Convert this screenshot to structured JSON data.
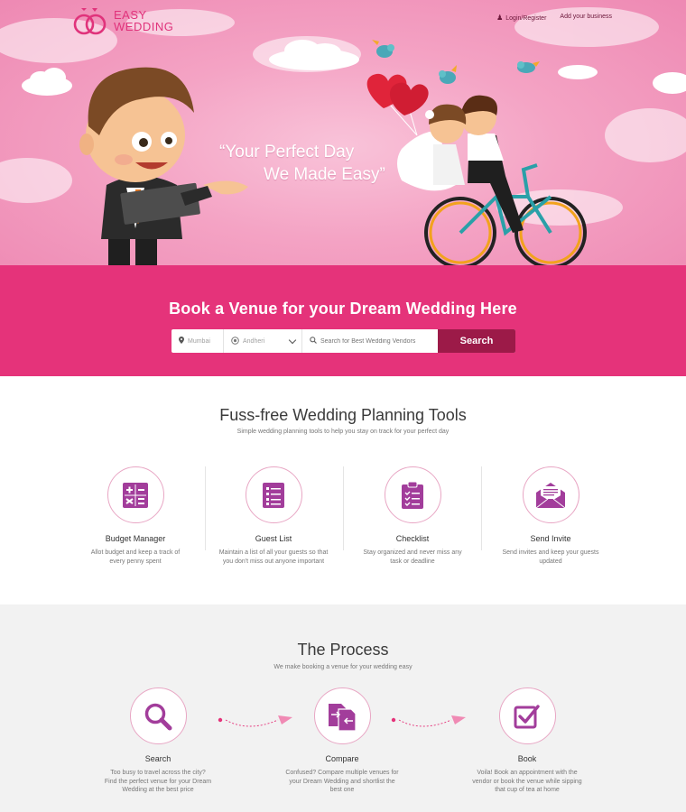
{
  "header": {
    "logo_line1": "EASY",
    "logo_line2": "WEDDING",
    "login_label": "Login/Register",
    "add_business_label": "Add your business"
  },
  "hero": {
    "quote_line1": "“Your Perfect Day",
    "quote_line2": "We Made Easy”"
  },
  "search": {
    "heading": "Book a Venue for your Dream Wedding Here",
    "city_value": "Mumbai",
    "area_value": "Andheri",
    "vendor_placeholder": "Search for Best Wedding Vendors",
    "button_label": "Search"
  },
  "tools": {
    "heading": "Fuss-free Wedding Planning Tools",
    "subheading": "Simple wedding planning tools to help you stay on track for your perfect day",
    "items": [
      {
        "title": "Budget Manager",
        "desc1": "Allot budget and keep a track of",
        "desc2": "every penny spent",
        "icon": "calculator-icon"
      },
      {
        "title": "Guest List",
        "desc1": "Maintain a list of all your guests so that",
        "desc2": "you don't miss out anyone important",
        "icon": "guest-list-icon"
      },
      {
        "title": "Checklist",
        "desc1": "Stay organized and never miss any",
        "desc2": "task or deadline",
        "icon": "clipboard-checklist-icon"
      },
      {
        "title": "Send Invite",
        "desc1": "Send invites and keep your guests",
        "desc2": "updated",
        "icon": "envelope-icon"
      }
    ]
  },
  "process": {
    "heading": "The Process",
    "subheading": "We make booking a venue for your wedding easy",
    "steps": [
      {
        "title": "Search",
        "desc1": "Too busy to travel across the city?",
        "desc2": "Find the perfect venue for your Dream",
        "desc3": "Wedding at the best price",
        "icon": "magnifier-icon"
      },
      {
        "title": "Compare",
        "desc1": "Confused? Compare multiple venues for",
        "desc2": "your Dream Wedding and shortlist the",
        "desc3": "best one",
        "icon": "compare-documents-icon"
      },
      {
        "title": "Book",
        "desc1": "Voila! Book an appointment with the",
        "desc2": "vendor or book the venue while sipping",
        "desc3": "that cup of tea at home",
        "icon": "checkbox-icon"
      }
    ]
  },
  "colors": {
    "brand_pink": "#e5337a",
    "button_dark": "#9c1a48",
    "icon_purple": "#a23d9b"
  }
}
